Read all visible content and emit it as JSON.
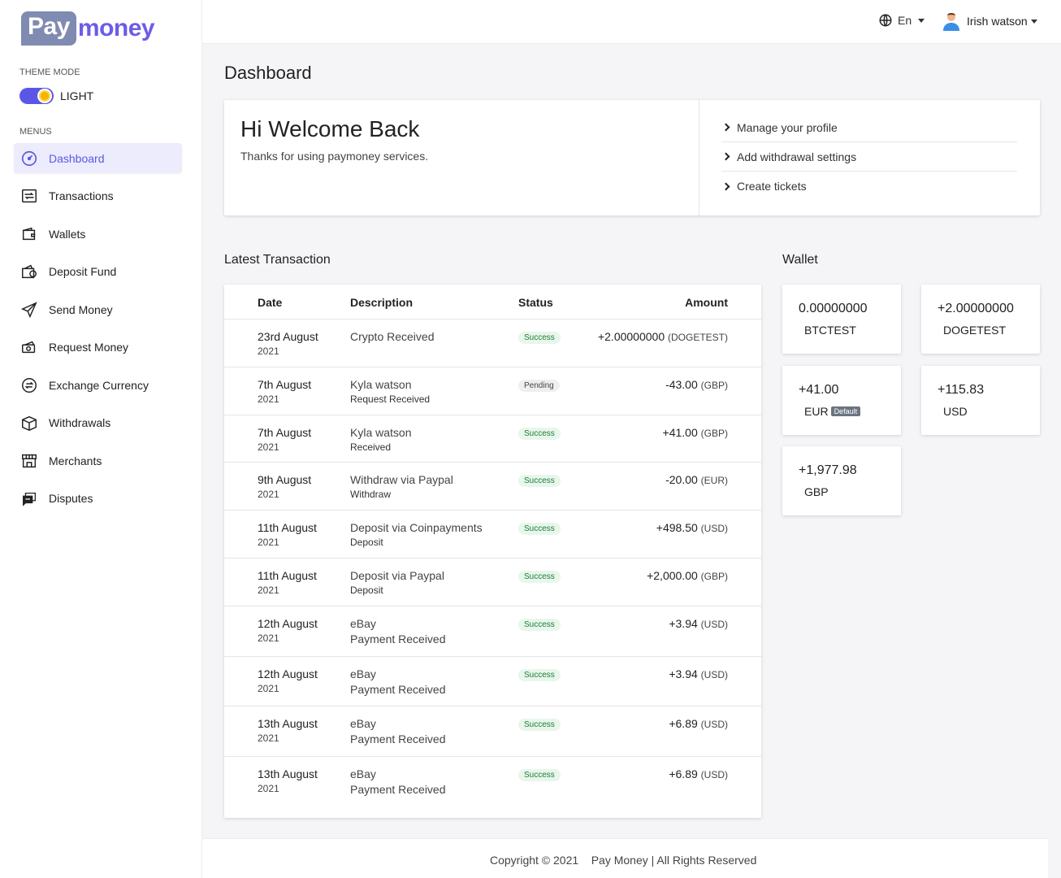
{
  "brand": {
    "logo_part1": "Pay",
    "logo_part2": "money"
  },
  "sidebar": {
    "theme_label": "THEME MODE",
    "theme_value": "LIGHT",
    "menus_label": "MENUS",
    "items": [
      {
        "label": "Dashboard",
        "icon": "dashboard-icon",
        "active": true
      },
      {
        "label": "Transactions",
        "icon": "transactions-icon"
      },
      {
        "label": "Wallets",
        "icon": "wallet-icon"
      },
      {
        "label": "Deposit Fund",
        "icon": "deposit-icon"
      },
      {
        "label": "Send Money",
        "icon": "send-icon"
      },
      {
        "label": "Request Money",
        "icon": "request-icon"
      },
      {
        "label": "Exchange Currency",
        "icon": "exchange-icon"
      },
      {
        "label": "Withdrawals",
        "icon": "withdrawal-icon"
      },
      {
        "label": "Merchants",
        "icon": "merchant-icon"
      },
      {
        "label": "Disputes",
        "icon": "dispute-icon"
      }
    ]
  },
  "topbar": {
    "language": "En",
    "user_name": "Irish watson"
  },
  "page": {
    "title": "Dashboard"
  },
  "welcome": {
    "title": "Hi Welcome Back",
    "subtitle": "Thanks for using paymoney services.",
    "links": [
      "Manage your profile",
      "Add withdrawal settings",
      "Create tickets"
    ]
  },
  "transactions": {
    "title": "Latest Transaction",
    "columns": {
      "date": "Date",
      "description": "Description",
      "status": "Status",
      "amount": "Amount"
    },
    "rows": [
      {
        "date": "23rd August",
        "year": "2021",
        "desc": "Crypto Received",
        "sub": "",
        "status": "Success",
        "amount": "+2.00000000",
        "currency": "(DOGETEST)"
      },
      {
        "date": "7th August",
        "year": "2021",
        "desc": "Kyla watson",
        "sub": "Request Received",
        "status": "Pending",
        "amount": "-43.00",
        "currency": "(GBP)"
      },
      {
        "date": "7th August",
        "year": "2021",
        "desc": "Kyla watson",
        "sub": "Received",
        "status": "Success",
        "amount": "+41.00",
        "currency": "(GBP)"
      },
      {
        "date": "9th August",
        "year": "2021",
        "desc": "Withdraw via Paypal",
        "sub": "Withdraw",
        "status": "Success",
        "amount": "-20.00",
        "currency": "(EUR)"
      },
      {
        "date": "11th August",
        "year": "2021",
        "desc": "Deposit via Coinpayments",
        "sub": "Deposit",
        "status": "Success",
        "amount": "+498.50",
        "currency": "(USD)"
      },
      {
        "date": "11th August",
        "year": "2021",
        "desc": "Deposit via Paypal",
        "sub": "Deposit",
        "status": "Success",
        "amount": "+2,000.00",
        "currency": "(GBP)"
      },
      {
        "date": "12th August",
        "year": "2021",
        "desc": "eBay",
        "sub": "Payment Received",
        "status": "Success",
        "amount": "+3.94",
        "currency": "(USD)"
      },
      {
        "date": "12th August",
        "year": "2021",
        "desc": "eBay",
        "sub": "Payment Received",
        "status": "Success",
        "amount": "+3.94",
        "currency": "(USD)"
      },
      {
        "date": "13th August",
        "year": "2021",
        "desc": "eBay",
        "sub": "Payment Received",
        "status": "Success",
        "amount": "+6.89",
        "currency": "(USD)"
      },
      {
        "date": "13th August",
        "year": "2021",
        "desc": "eBay",
        "sub": "Payment Received",
        "status": "Success",
        "amount": "+6.89",
        "currency": "(USD)"
      }
    ]
  },
  "wallet": {
    "title": "Wallet",
    "default_label": "Default",
    "cards": [
      {
        "balance": "0.00000000",
        "currency": "BTCTEST"
      },
      {
        "balance": "+2.00000000",
        "currency": "DOGETEST"
      },
      {
        "balance": "+41.00",
        "currency": "EUR",
        "default": true
      },
      {
        "balance": "+115.83",
        "currency": "USD"
      },
      {
        "balance": "+1,977.98",
        "currency": "GBP"
      }
    ]
  },
  "footer": {
    "copyright": "Copyright © 2021",
    "brand": "Pay Money",
    "rights": "All Rights Reserved"
  },
  "colors": {
    "accent": "#5a57e6",
    "success_bg": "#e8f6ec",
    "success_text": "#1e7e34"
  }
}
